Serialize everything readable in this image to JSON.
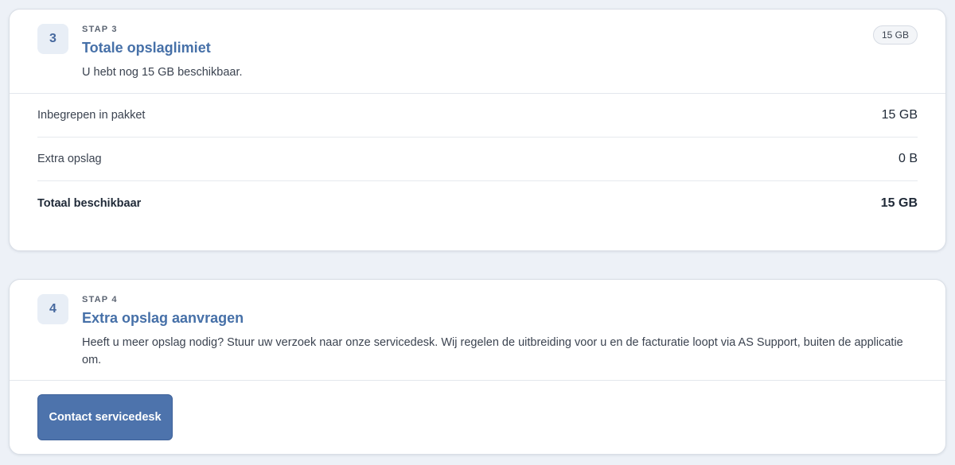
{
  "step3": {
    "number": "3",
    "eyebrow": "STAP 3",
    "title": "Totale opslaglimiet",
    "description": "U hebt nog 15 GB beschikbaar.",
    "badge": "15 GB",
    "rows": [
      {
        "label": "Inbegrepen in pakket",
        "value": "15 GB"
      },
      {
        "label": "Extra opslag",
        "value": "0 B"
      },
      {
        "label": "Totaal beschikbaar",
        "value": "15 GB"
      }
    ]
  },
  "step4": {
    "number": "4",
    "eyebrow": "STAP 4",
    "title": "Extra opslag aanvragen",
    "description": "Heeft u meer opslag nodig? Stuur uw verzoek naar onze servicedesk. Wij regelen de uitbreiding voor u en de facturatie loopt via AS Support, buiten de applicatie om.",
    "button_label": "Contact servicedesk"
  },
  "colors": {
    "page_background": "#edf1f7",
    "accent": "#4670a8",
    "button": "#4d73ac"
  }
}
